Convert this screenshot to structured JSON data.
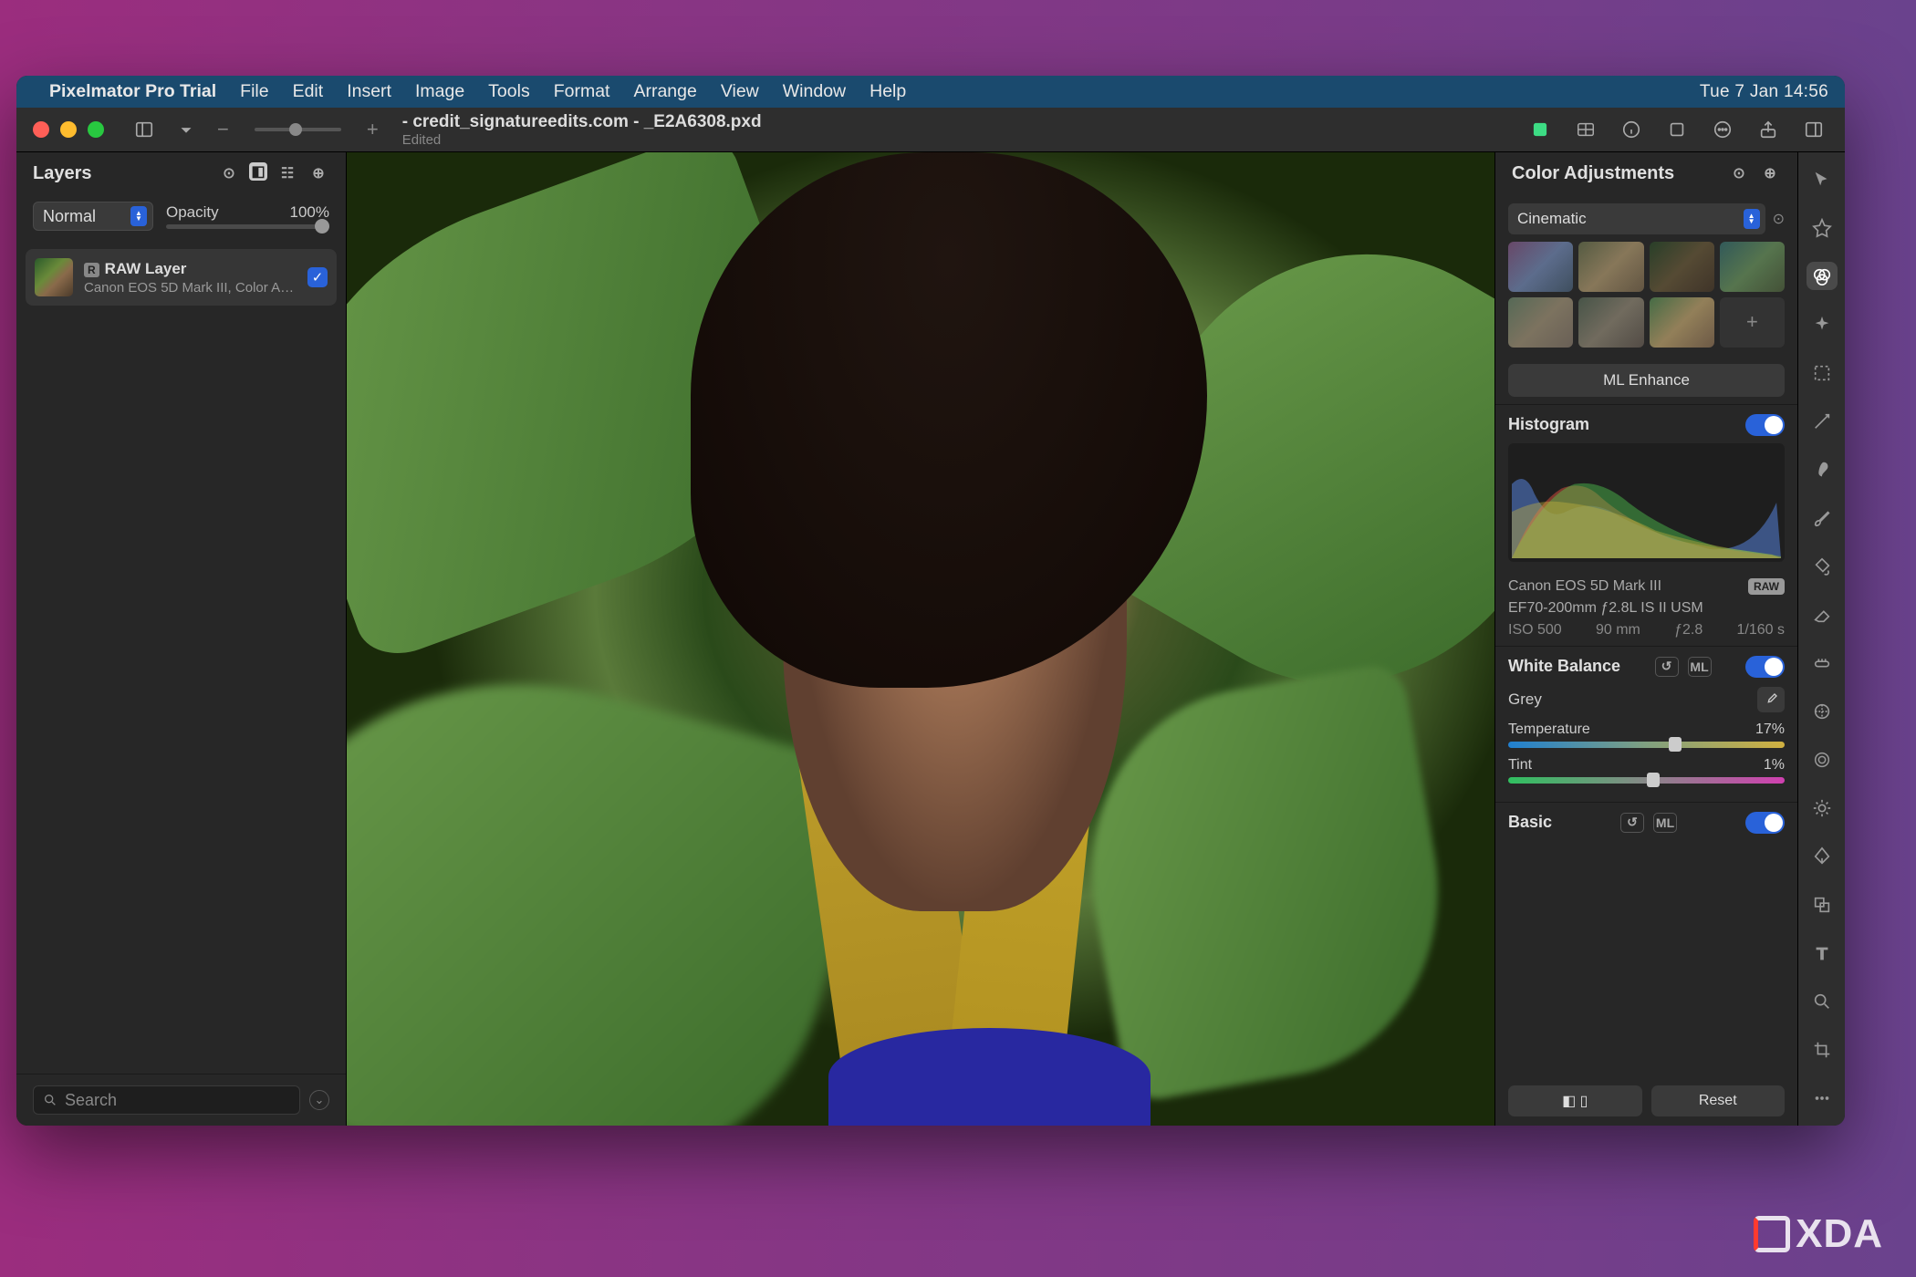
{
  "menubar": {
    "app": "Pixelmator Pro Trial",
    "items": [
      "File",
      "Edit",
      "Insert",
      "Image",
      "Tools",
      "Format",
      "Arrange",
      "View",
      "Window",
      "Help"
    ],
    "datetime": "Tue 7 Jan  14:56"
  },
  "toolbar": {
    "title": "- credit_signatureedits.com - _E2A6308.pxd",
    "subtitle": "Edited"
  },
  "layers": {
    "title": "Layers",
    "blend_mode": "Normal",
    "opacity_label": "Opacity",
    "opacity_value": "100%",
    "item": {
      "badge": "R",
      "name": "RAW Layer",
      "sub": "Canon EOS 5D Mark III, Color A…"
    },
    "search_placeholder": "Search"
  },
  "adjust": {
    "title": "Color Adjustments",
    "preset_group": "Cinematic",
    "ml_button": "ML Enhance",
    "histogram_label": "Histogram",
    "camera": "Canon EOS 5D Mark III",
    "lens": "EF70-200mm ƒ2.8L IS II USM",
    "raw_badge": "RAW",
    "exif": {
      "iso": "ISO 500",
      "focal": "90 mm",
      "aperture": "ƒ2.8",
      "shutter": "1/160 s"
    },
    "wb_label": "White Balance",
    "ml_badge": "ML",
    "grey": "Grey",
    "temp_label": "Temperature",
    "temp_value": "17%",
    "tint_label": "Tint",
    "tint_value": "1%",
    "basic_label": "Basic",
    "reset": "Reset"
  },
  "watermark": "XDA"
}
